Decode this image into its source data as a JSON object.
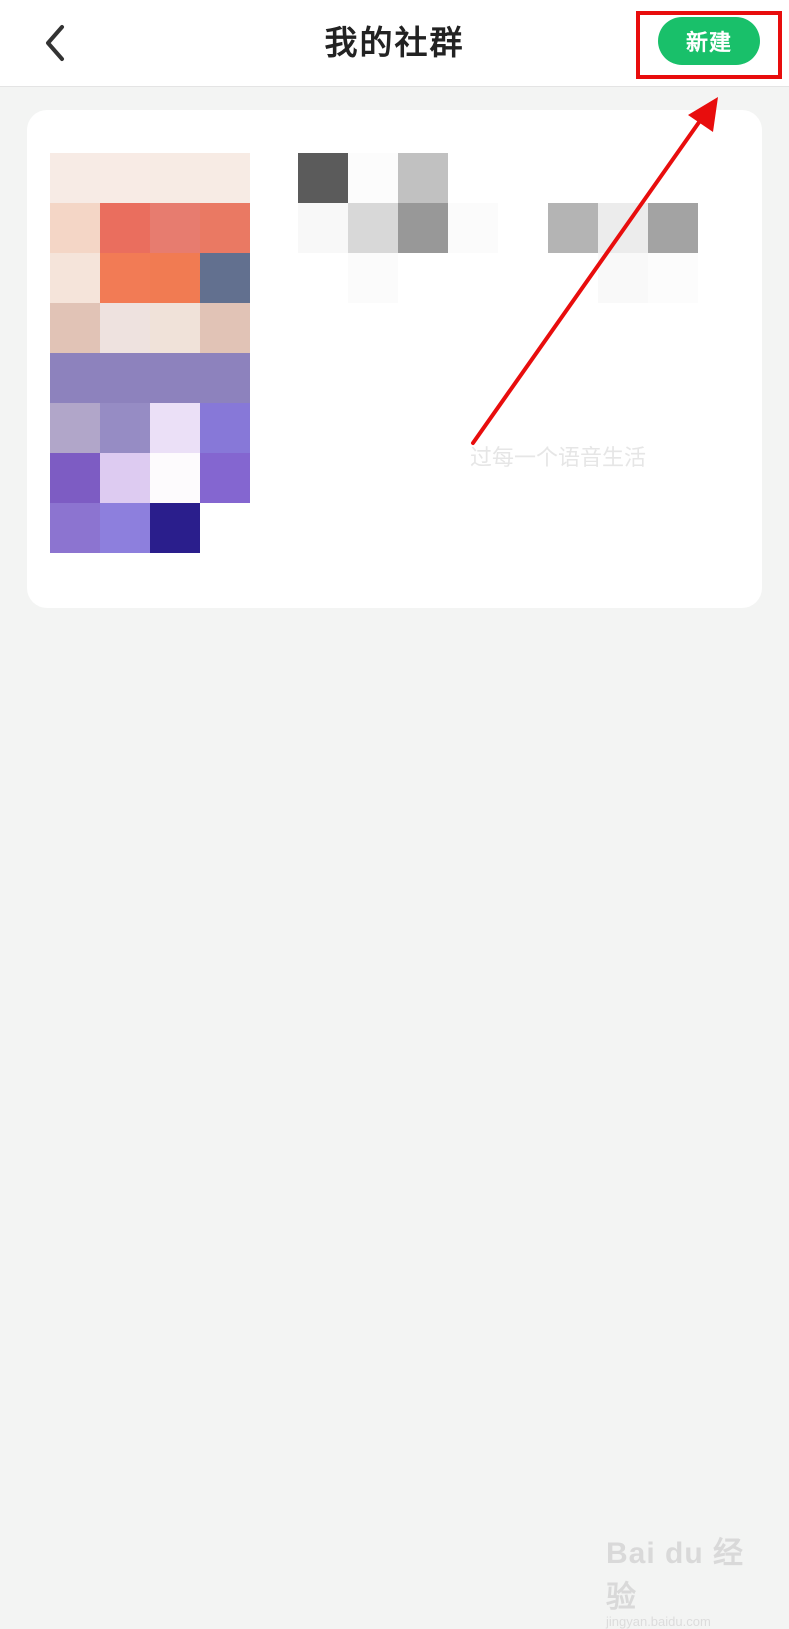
{
  "header": {
    "back_icon": "chevron-left-icon",
    "title": "我的社群",
    "new_button_label": "新建"
  },
  "annotation": {
    "highlight_color": "#e80d0d",
    "arrow_color": "#e80d0d"
  },
  "card": {
    "faint_text": "过每一个语音生活"
  },
  "watermark": {
    "brand": "Bai du 经验",
    "url": "jingyan.baidu.com"
  },
  "colors": {
    "accent": "#19c06a",
    "background": "#f3f4f3"
  }
}
